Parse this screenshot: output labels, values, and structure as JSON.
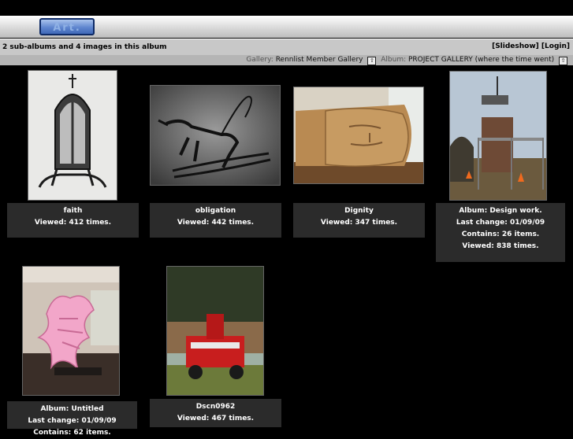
{
  "header": {
    "album_button_label": "Art."
  },
  "infobar": {
    "summary": "2 sub-albums and 4 images in this album",
    "slideshow_label": "[Slideshow]",
    "login_label": "[Login]"
  },
  "breadcrumb": {
    "gallery_label": "Gallery:",
    "gallery_name": "Rennlist Member Gallery",
    "album_label": "Album:",
    "album_name": "PROJECT GALLERY (where the time went)",
    "up_symbol": "⇧"
  },
  "items": [
    {
      "title": "faith",
      "viewed": "Viewed: 412 times."
    },
    {
      "title": "obligation",
      "viewed": "Viewed: 442 times."
    },
    {
      "title": "Dignity",
      "viewed": "Viewed: 347 times."
    },
    {
      "title": "Album:  Design work.",
      "last_change": "Last change: 01/09/09",
      "contains": "Contains: 26 items.",
      "viewed": "Viewed: 838 times."
    },
    {
      "title": "Album:  Untitled",
      "last_change": "Last change: 01/09/09",
      "contains": "Contains: 62 items."
    },
    {
      "title": "Dscn0962",
      "viewed": "Viewed: 467 times."
    }
  ]
}
